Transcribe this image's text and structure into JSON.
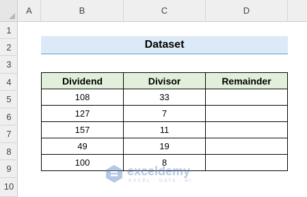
{
  "columns": [
    "A",
    "B",
    "C",
    "D"
  ],
  "rows": [
    "1",
    "2",
    "3",
    "4",
    "5",
    "6",
    "7",
    "8",
    "9",
    "10"
  ],
  "title": "Dataset",
  "table": {
    "headers": [
      "Dividend",
      "Divisor",
      "Remainder"
    ],
    "rows": [
      [
        "108",
        "33",
        ""
      ],
      [
        "127",
        "7",
        ""
      ],
      [
        "157",
        "11",
        ""
      ],
      [
        "49",
        "19",
        ""
      ],
      [
        "100",
        "8",
        ""
      ]
    ]
  },
  "watermark": {
    "name": "exceldemy",
    "tagline": "EXCEL · DATA · BI",
    "icon": "exceldemy-logo-icon"
  },
  "colors": {
    "title_fill": "#dce9f7",
    "title_border": "#9dc3e6",
    "header_fill": "#e2efda",
    "watermark": "#5a86c4"
  }
}
